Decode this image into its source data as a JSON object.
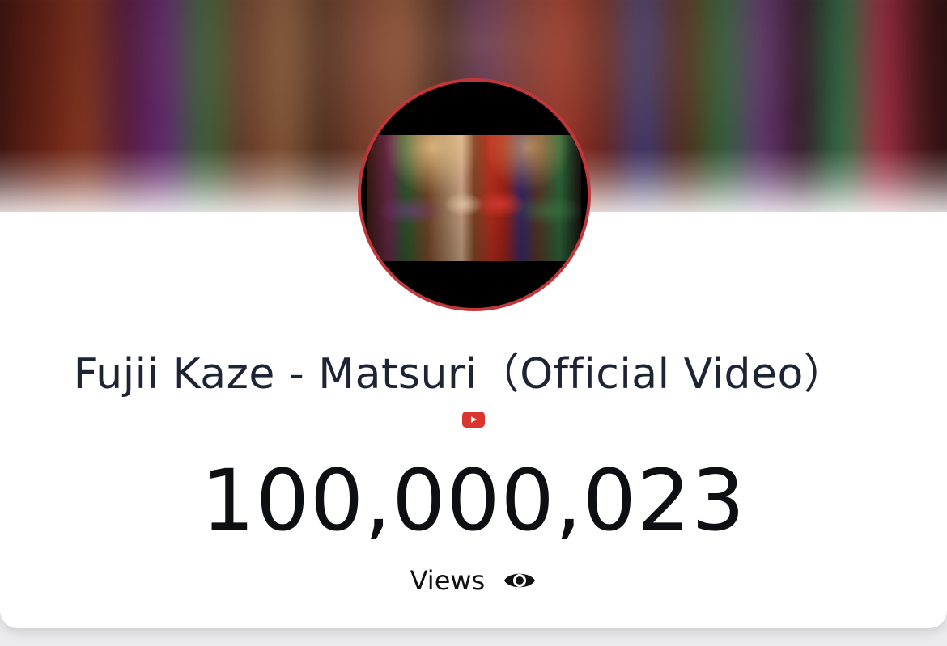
{
  "video": {
    "title": "Fujii Kaze - Matsuri（Official Video）",
    "platform_icon": "youtube-icon",
    "view_count": "100,000,023",
    "views_label": "Views",
    "views_icon": "eye-icon"
  },
  "colors": {
    "avatar_border": "#c0363a",
    "youtube_red": "#d8362e",
    "title_text": "#1d2433",
    "count_text": "#0e0f12",
    "card_background": "#ffffff",
    "page_background": "#ececee"
  }
}
